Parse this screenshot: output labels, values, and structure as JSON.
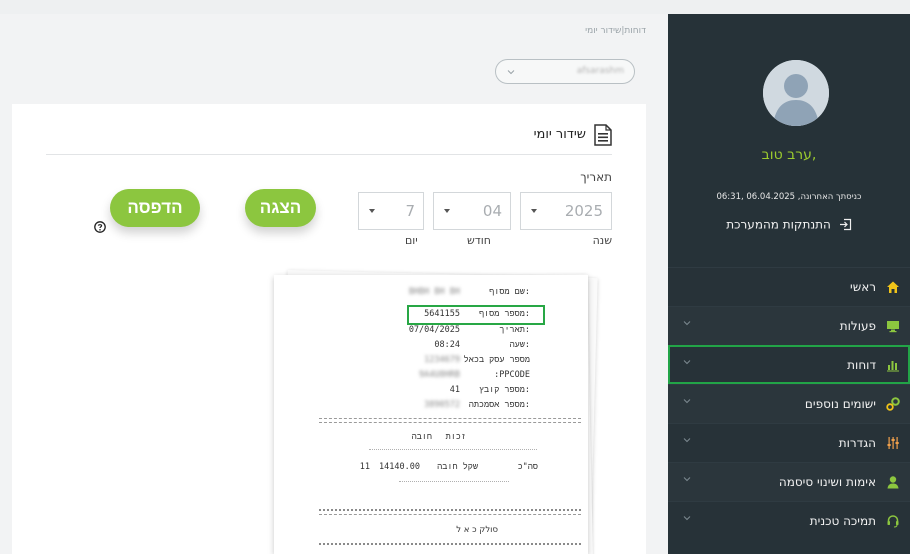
{
  "sidebar": {
    "greeting": "ערב טוב,",
    "last_login": "כניסתך האחרונה, 06.04.2025 ,06:31",
    "logout_label": "התנתקות מהמערכת",
    "menu": [
      {
        "label": "ראשי",
        "icon": "home-icon",
        "icon_color": "#f0c419",
        "has_chevron": false
      },
      {
        "label": "פעולות",
        "icon": "monitor-icon",
        "icon_color": "#8cc63f",
        "has_chevron": true
      },
      {
        "label": "דוחות",
        "icon": "bar-chart-icon",
        "icon_color": "#8cc63f",
        "has_chevron": true,
        "selected": true
      },
      {
        "label": "ישומים נוספים",
        "icon": "gears-icon",
        "icon_color": "#8cc63f",
        "has_chevron": true
      },
      {
        "label": "הגדרות",
        "icon": "sliders-icon",
        "icon_color": "#f0a04b",
        "has_chevron": true
      },
      {
        "label": "אימות ושינוי סיסמה",
        "icon": "user-icon",
        "icon_color": "#8cc63f",
        "has_chevron": true
      },
      {
        "label": "תמיכה טכנית",
        "icon": "headset-icon",
        "icon_color": "#8cc63f",
        "has_chevron": true
      }
    ]
  },
  "main": {
    "breadcrumb": "דוחות|שידור יומי",
    "user_select_value": "afsarashm",
    "card_title": "שידור יומי",
    "date_label": "תאריך",
    "year_value": "2025",
    "month_value": "04",
    "day_value": "7",
    "year_label": "שנה",
    "month_label": "חודש",
    "day_label": "יום",
    "show_button": "הצגה",
    "print_button": "הדפסה"
  },
  "receipt": {
    "rows": [
      {
        "label": "שם מסוף:",
        "value": "BHBH BH BH",
        "blurred": true
      },
      {
        "label": "מספר מסוף:",
        "value": "5641155",
        "blurred": false
      },
      {
        "label": "תאריך:",
        "value": "07/04/2025",
        "blurred": false
      },
      {
        "label": "שעה:",
        "value": "08:24",
        "blurred": false
      },
      {
        "label": "מספר עסק בכאל",
        "value": "1234679",
        "blurred": true
      },
      {
        "label": ":PPCODE",
        "value": "9A4U8HRB",
        "blurred": true
      },
      {
        "label": "מספר קובץ:",
        "value": "41",
        "blurred": false
      },
      {
        "label": "מספר אסמכתה:",
        "value": "3890572",
        "blurred": true
      }
    ],
    "header_credit": "זכות",
    "header_debit": "חובה",
    "total_label": "סה\"כ",
    "total_type": "שקל חובה",
    "total_amount": "14140.00",
    "total_count": "11",
    "clearer": "סולק כ א ל"
  },
  "colors": {
    "sidebar_bg": "#263238",
    "accent_green": "#8cc63f",
    "highlight_green": "#28a745"
  }
}
